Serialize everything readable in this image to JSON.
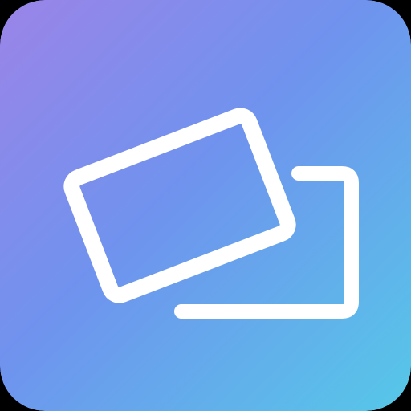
{
  "icon": {
    "name": "cards-icon",
    "description_label": "",
    "colors": {
      "gradient_start": "#9b84e8",
      "gradient_mid": "#6f93ee",
      "gradient_end": "#56c8e8",
      "glyph": "#ffffff"
    }
  }
}
